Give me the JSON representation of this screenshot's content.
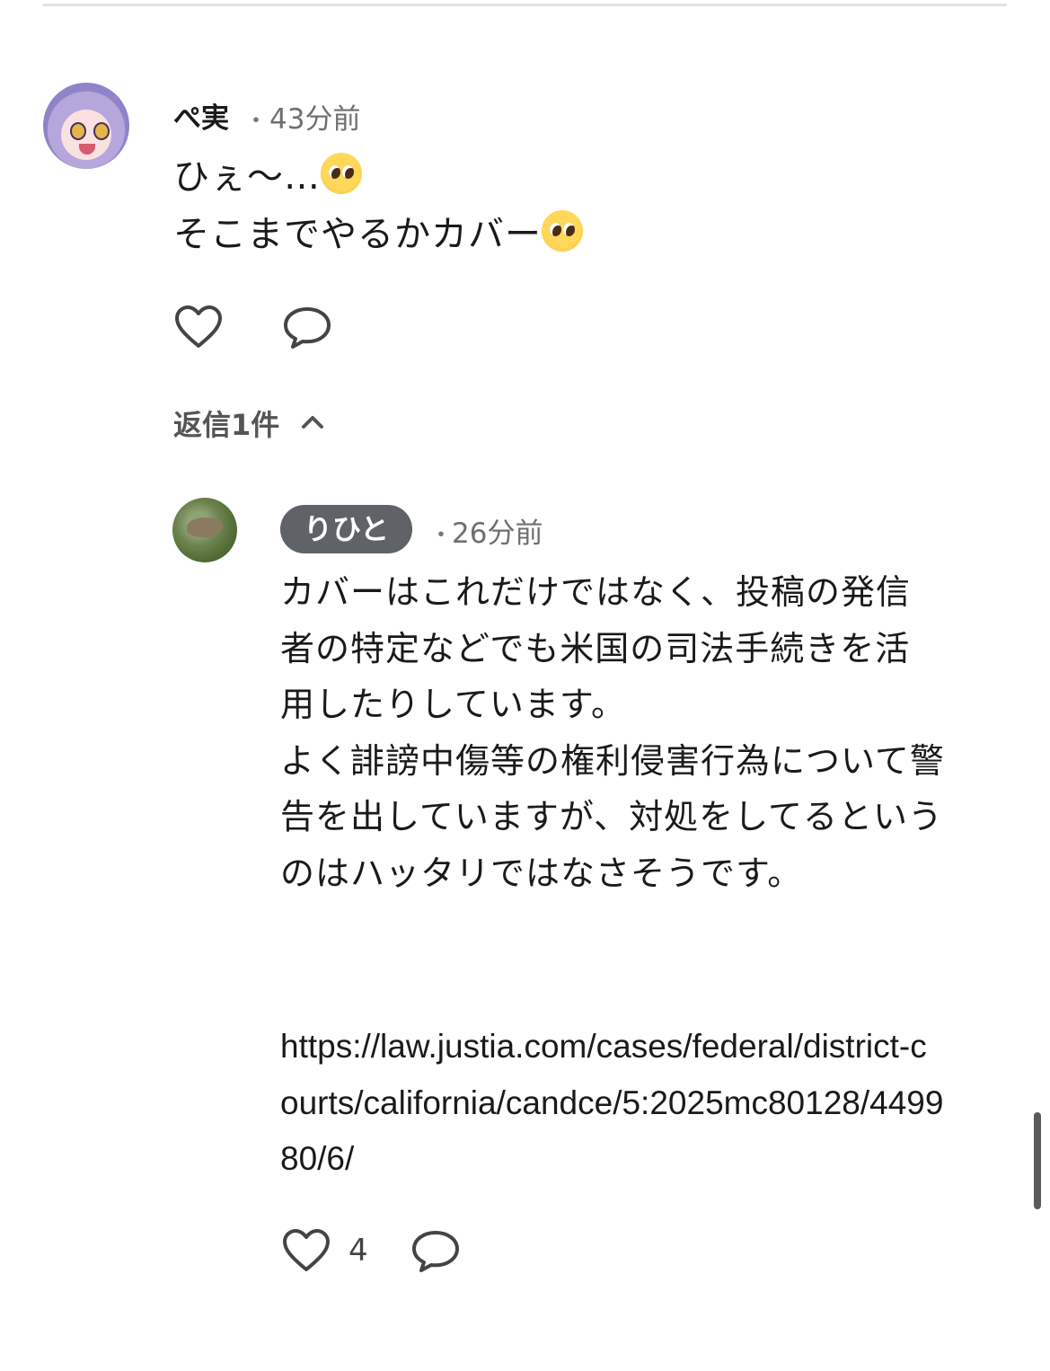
{
  "comment": {
    "username": "ぺ実",
    "separator": "・",
    "time": "43分前",
    "text_line1": "ひぇ〜…",
    "text_line2": "そこまでやるかカバー",
    "emoji_name": "pleading-face-emoji",
    "replies_label": "返信1件"
  },
  "reply": {
    "username": "りひと",
    "separator": "・",
    "time": "26分前",
    "text": "カバーはこれだけではなく、投稿の発信者の特定などでも米国の司法手続きを活用したりしています。\nよく誹謗中傷等の権利侵害行為について警告を出していますが、対処をしてるというのはハッタリではなさそうです。",
    "link": "https://law.justia.com/cases/federal/district-courts/california/candce/5:2025mc80128/449980/6/",
    "like_count": "4"
  },
  "icons": {
    "like": "heart-icon",
    "reply": "speech-bubble-icon",
    "toggle": "chevron-up-icon"
  },
  "colors": {
    "badge_bg": "#5f6368",
    "text": "#1a1a1a",
    "muted": "#6f6f6f"
  }
}
